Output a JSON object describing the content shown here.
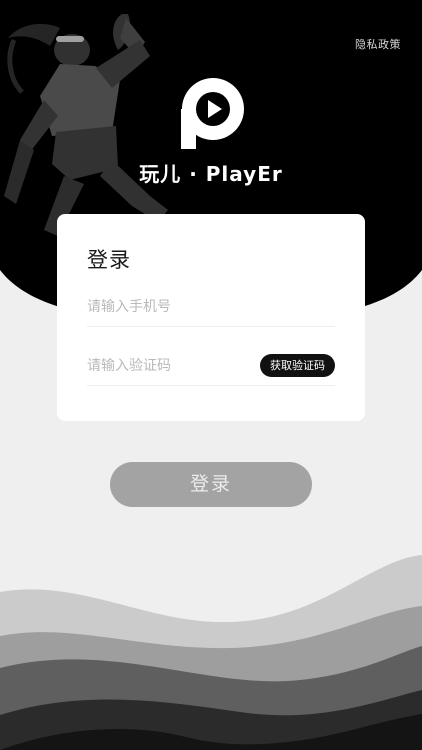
{
  "header": {
    "privacy_link": "隐私政策"
  },
  "brand": {
    "name": "玩儿 · PlayEr",
    "logo": "play-p-logo-icon"
  },
  "login_card": {
    "title": "登录",
    "phone_placeholder": "请输入手机号",
    "phone_value": "",
    "code_placeholder": "请输入验证码",
    "code_value": "",
    "get_code_label": "获取验证码"
  },
  "submit": {
    "label": "登录"
  },
  "colors": {
    "header_bg": "#000000",
    "page_bg": "#efefef",
    "card_bg": "#ffffff",
    "submit_disabled": "#a3a3a3",
    "wave_dark": "#2b2b2b"
  }
}
